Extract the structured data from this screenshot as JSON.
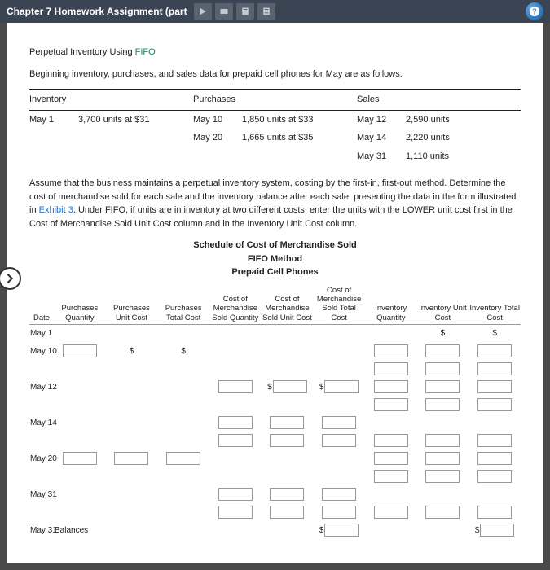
{
  "titlebar": {
    "title": "Chapter 7 Homework Assignment (part"
  },
  "intro": {
    "title_pre": "Perpetual Inventory Using ",
    "title_method": "FIFO",
    "lead": "Beginning inventory, purchases, and sales data for prepaid cell phones for May are as follows:"
  },
  "data_table": {
    "headers": {
      "c1": "Inventory",
      "c2": "Purchases",
      "c3": "Sales"
    },
    "inventory": [
      {
        "date": "May 1",
        "desc": "3,700 units at $31"
      }
    ],
    "purchases": [
      {
        "date": "May 10",
        "desc": "1,850 units at $33"
      },
      {
        "date": "May 20",
        "desc": "1,665 units at $35"
      }
    ],
    "sales": [
      {
        "date": "May 12",
        "desc": "2,590 units"
      },
      {
        "date": "May 14",
        "desc": "2,220 units"
      },
      {
        "date": "May 31",
        "desc": "1,110 units"
      }
    ]
  },
  "instructions": {
    "p1_pre": "Assume that the business maintains a perpetual inventory system, costing by the first-in, first-out method. Determine the cost of merchandise sold for each sale and the inventory balance after each sale, presenting the data in the form illustrated in ",
    "exhibit": "Exhibit 3",
    "p1_post": ". Under FIFO, if units are in inventory at two different costs, enter the units with the LOWER unit cost first in the Cost of Merchandise Sold Unit Cost column and in the Inventory Unit Cost column."
  },
  "schedule": {
    "title": "Schedule of Cost of Merchandise Sold",
    "method": "FIFO Method",
    "product": "Prepaid Cell Phones",
    "cols": {
      "date": "Date",
      "pq": "Purchases Quantity",
      "puc": "Purchases Unit Cost",
      "ptc": "Purchases Total Cost",
      "cmsq": "Cost of Merchandise Sold Quantity",
      "cmsuc": "Cost of Merchandise Sold Unit Cost",
      "cmstc": "Cost of Merchandise Sold Total Cost",
      "iq": "Inventory Quantity",
      "iuc": "Inventory Unit Cost",
      "itc": "Inventory Total Cost"
    },
    "rows": {
      "may1": "May 1",
      "may10": "May 10",
      "may12": "May 12",
      "may14": "May 14",
      "may20": "May 20",
      "may31": "May 31",
      "may31b": "May 31",
      "balances": "Balances"
    }
  },
  "sym": {
    "dollar": "$"
  }
}
